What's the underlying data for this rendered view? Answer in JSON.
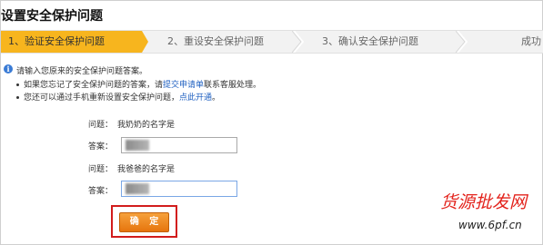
{
  "page": {
    "title": "设置安全保护问题"
  },
  "steps": [
    {
      "label": "1、验证安全保护问题",
      "active": true
    },
    {
      "label": "2、重设安全保护问题",
      "active": false
    },
    {
      "label": "3、确认安全保护问题",
      "active": false
    },
    {
      "label": "成功",
      "active": false
    }
  ],
  "info": {
    "intro": "请输入您原来的安全保护问题答案。",
    "forgot_prefix": "如果您忘记了安全保护问题的答案，请",
    "forgot_link": "提交申请单",
    "forgot_suffix": "联系客服处理。",
    "mobile_prefix": "您还可以通过手机重新设置安全保护问题，",
    "mobile_link": "点此开通",
    "mobile_suffix": "。"
  },
  "form": {
    "question_label": "问题：",
    "answer_label": "答案：",
    "q1": "我奶奶的名字是",
    "q2": "我爸爸的名字是"
  },
  "buttons": {
    "confirm": "确 定"
  },
  "watermark": {
    "cn": "货源批发网",
    "url": "www.6pf.cn"
  },
  "colors": {
    "active_step": "#f7b51e",
    "confirm_button": "#f08a1e",
    "highlight_border": "#d21c1c",
    "link": "#1e5fc0",
    "watermark": "#e3231c"
  }
}
